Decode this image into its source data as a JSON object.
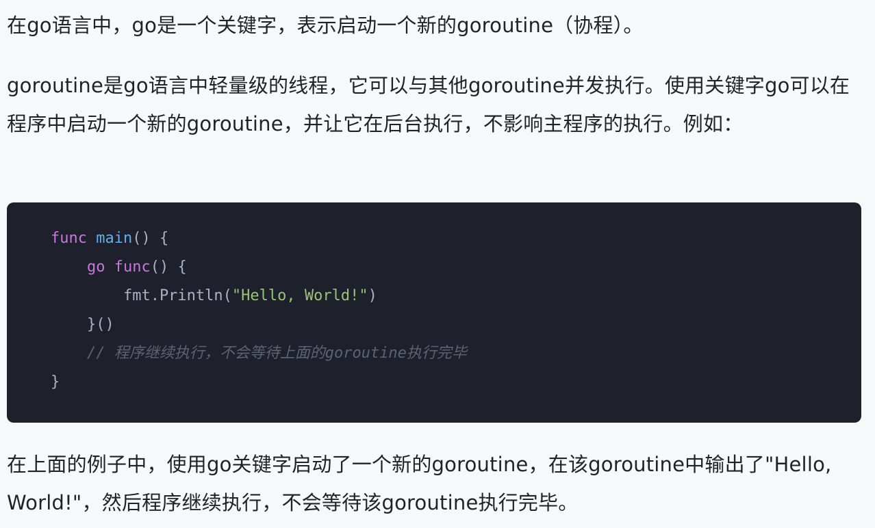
{
  "paragraphs": {
    "intro": "在go语言中，go是一个关键字，表示启动一个新的goroutine（协程）。",
    "explanation": "goroutine是go语言中轻量级的线程，它可以与其他goroutine并发执行。使用关键字go可以在程序中启动一个新的goroutine，并让它在后台执行，不影响主程序的执行。例如：",
    "conclusion": "在上面的例子中，使用go关键字启动了一个新的goroutine，在该goroutine中输出了\"Hello, World!\"，然后程序继续执行，不会等待该goroutine执行完毕。"
  },
  "code": {
    "language": "go",
    "lines": [
      [
        {
          "t": "kw",
          "v": "func"
        },
        {
          "t": "plain",
          "v": " "
        },
        {
          "t": "fn",
          "v": "main"
        },
        {
          "t": "plain",
          "v": "() {"
        }
      ],
      [
        {
          "t": "plain",
          "v": "    "
        },
        {
          "t": "kw",
          "v": "go"
        },
        {
          "t": "plain",
          "v": " "
        },
        {
          "t": "kw",
          "v": "func"
        },
        {
          "t": "plain",
          "v": "() {"
        }
      ],
      [
        {
          "t": "plain",
          "v": "        fmt.Println("
        },
        {
          "t": "str",
          "v": "\"Hello, World!\""
        },
        {
          "t": "plain",
          "v": ")"
        }
      ],
      [
        {
          "t": "plain",
          "v": "    }()"
        }
      ],
      [
        {
          "t": "plain",
          "v": "    "
        },
        {
          "t": "comment",
          "v": "// 程序继续执行，不会等待上面的goroutine执行完毕"
        }
      ],
      [
        {
          "t": "plain",
          "v": "}"
        }
      ]
    ]
  },
  "colors": {
    "page_background": "#f7f8fa",
    "text": "#1f2329",
    "code_background": "#1e202b",
    "keyword": "#c678dd",
    "function_name": "#61afef",
    "string": "#98c379",
    "comment": "#5c6370",
    "plain": "#abb2bf"
  }
}
